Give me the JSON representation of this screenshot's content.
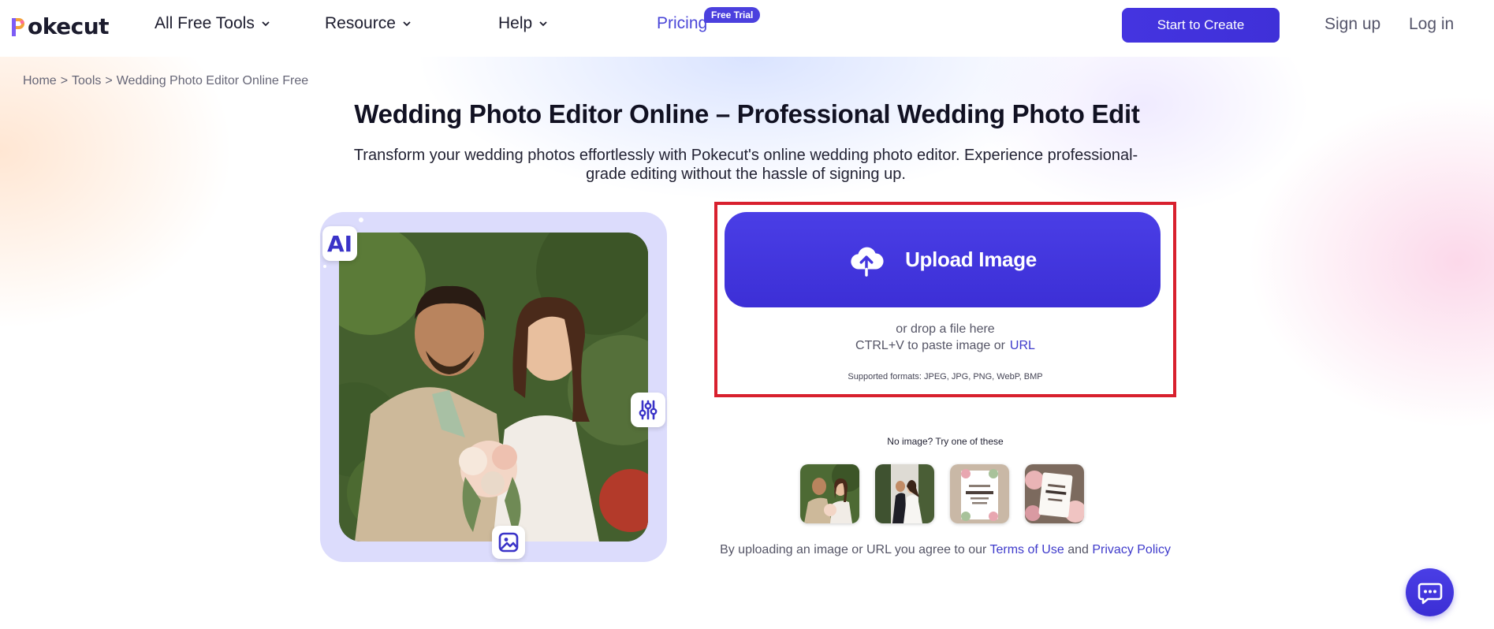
{
  "header": {
    "logo_text": "okecut",
    "nav": [
      {
        "label": "All Free Tools"
      },
      {
        "label": "Resource"
      },
      {
        "label": "Help"
      },
      {
        "label": "Pricing"
      }
    ],
    "pricing_badge": "Free Trial",
    "cta_label": "Start to Create",
    "signup_label": "Sign up",
    "login_label": "Log in"
  },
  "breadcrumb": {
    "items": [
      "Home",
      "Tools",
      "Wedding Photo Editor Online Free"
    ],
    "separator": ">"
  },
  "hero": {
    "title": "Wedding Photo Editor Online – Professional Wedding Photo Edit",
    "subtitle": "Transform your wedding photos effortlessly with Pokecut's online wedding photo editor. Experience professional-grade editing without the hassle of signing up."
  },
  "preview": {
    "ai_badge": "AI",
    "icons": [
      "sliders-icon",
      "image-icon"
    ]
  },
  "upload": {
    "button_label": "Upload Image",
    "drop_text": "or drop a file here",
    "paste_text": "CTRL+V to paste image or",
    "url_label": "URL",
    "formats_text": "Supported formats: JPEG, JPG, PNG, WebP, BMP",
    "highlight_color": "#d8202e"
  },
  "samples": {
    "prompt": "No image? Try one of these"
  },
  "terms": {
    "prefix": "By uploading an image or URL you agree to our",
    "terms_label": "Terms of Use",
    "and": "and",
    "privacy_label": "Privacy Policy"
  },
  "colors": {
    "accent": "#4434e0",
    "link": "#3e3acb",
    "card_bg": "#dcdcfc"
  }
}
